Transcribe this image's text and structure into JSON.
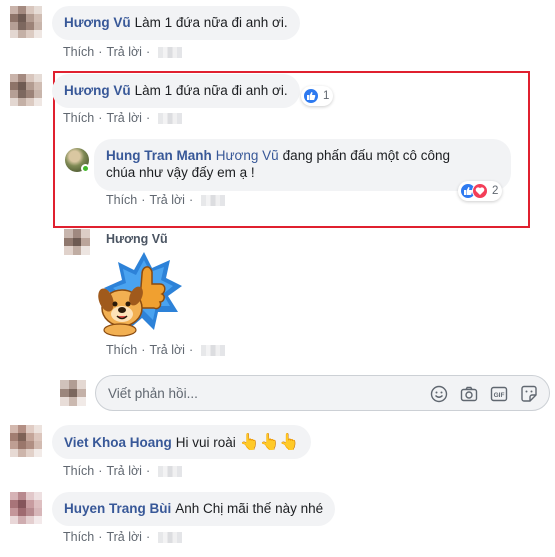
{
  "comments": [
    {
      "name": "Hương Vũ",
      "text": "Làm 1 đứa nữa đi anh ơi.",
      "like": "Thích",
      "reply": "Trả lời"
    },
    {
      "name": "Hương Vũ",
      "text": "Làm 1 đứa nữa đi anh ơi.",
      "like": "Thích",
      "reply": "Trả lời",
      "reaction_count": "1"
    },
    {
      "name": "Viet Khoa Hoang",
      "text": "Hi vui roài",
      "like": "Thích",
      "reply": "Trả lời"
    },
    {
      "name": "Huyen Trang Bùi",
      "text": "Anh Chị mãi thế này nhé",
      "like": "Thích",
      "reply": "Trả lời"
    }
  ],
  "replies": [
    {
      "name": "Hung Tran Manh",
      "mention": "Hương Vũ",
      "text_line1": "đang phấn đấu một cô công",
      "text_line2": "chúa như vậy đấy em ạ !",
      "like": "Thích",
      "reply": "Trả lời",
      "reaction_count": "2"
    },
    {
      "name": "Hương Vũ",
      "like": "Thích",
      "reply": "Trả lời"
    }
  ],
  "reply_box": {
    "placeholder": "Viết phản hồi..."
  },
  "icons": {
    "emoji": "smiley-icon",
    "camera": "camera-icon",
    "gif": "GIF",
    "sticker": "sticker-icon",
    "hands": "👆👆👆"
  },
  "colors": {
    "name": "#385898",
    "highlight": "#e0202f",
    "like": "#2e7af0",
    "love": "#f33e58",
    "bubble": "#f2f3f5"
  }
}
